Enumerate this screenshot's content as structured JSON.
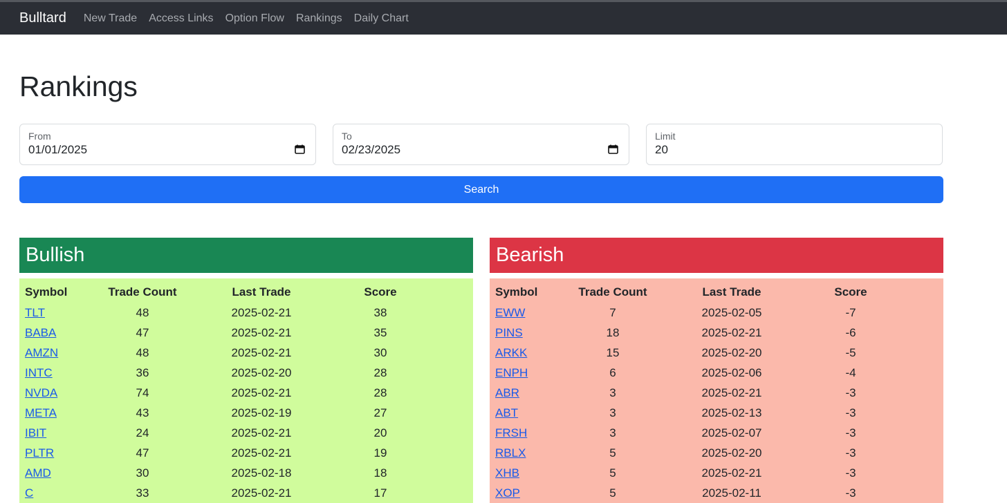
{
  "nav": {
    "brand": "Bulltard",
    "links": [
      "New Trade",
      "Access Links",
      "Option Flow",
      "Rankings",
      "Daily Chart"
    ]
  },
  "page_title": "Rankings",
  "filters": {
    "from": {
      "label": "From",
      "value": "01/01/2025"
    },
    "to": {
      "label": "To",
      "value": "02/23/2025"
    },
    "limit": {
      "label": "Limit",
      "value": "20"
    }
  },
  "search_label": "Search",
  "columns": [
    "Symbol",
    "Trade Count",
    "Last Trade",
    "Score"
  ],
  "bullish": {
    "title": "Bullish",
    "rows": [
      [
        "TLT",
        "48",
        "2025-02-21",
        "38"
      ],
      [
        "BABA",
        "47",
        "2025-02-21",
        "35"
      ],
      [
        "AMZN",
        "48",
        "2025-02-21",
        "30"
      ],
      [
        "INTC",
        "36",
        "2025-02-20",
        "28"
      ],
      [
        "NVDA",
        "74",
        "2025-02-21",
        "28"
      ],
      [
        "META",
        "43",
        "2025-02-19",
        "27"
      ],
      [
        "IBIT",
        "24",
        "2025-02-21",
        "20"
      ],
      [
        "PLTR",
        "47",
        "2025-02-21",
        "19"
      ],
      [
        "AMD",
        "30",
        "2025-02-18",
        "18"
      ],
      [
        "C",
        "33",
        "2025-02-21",
        "17"
      ]
    ]
  },
  "bearish": {
    "title": "Bearish",
    "rows": [
      [
        "EWW",
        "7",
        "2025-02-05",
        "-7"
      ],
      [
        "PINS",
        "18",
        "2025-02-21",
        "-6"
      ],
      [
        "ARKK",
        "15",
        "2025-02-20",
        "-5"
      ],
      [
        "ENPH",
        "6",
        "2025-02-06",
        "-4"
      ],
      [
        "ABR",
        "3",
        "2025-02-21",
        "-3"
      ],
      [
        "ABT",
        "3",
        "2025-02-13",
        "-3"
      ],
      [
        "FRSH",
        "3",
        "2025-02-07",
        "-3"
      ],
      [
        "RBLX",
        "5",
        "2025-02-20",
        "-3"
      ],
      [
        "XHB",
        "5",
        "2025-02-21",
        "-3"
      ],
      [
        "XOP",
        "5",
        "2025-02-11",
        "-3"
      ]
    ]
  },
  "colors": {
    "navbar": "#2b2e35",
    "primary": "#1f6ff5",
    "bullish_header": "#198754",
    "bullish_bg": "#d0fc9c",
    "bearish_header": "#dc3545",
    "bearish_bg": "#fbb9ab",
    "link": "#1a5ae8"
  },
  "icons": {
    "date_picker": "calendar-icon"
  }
}
